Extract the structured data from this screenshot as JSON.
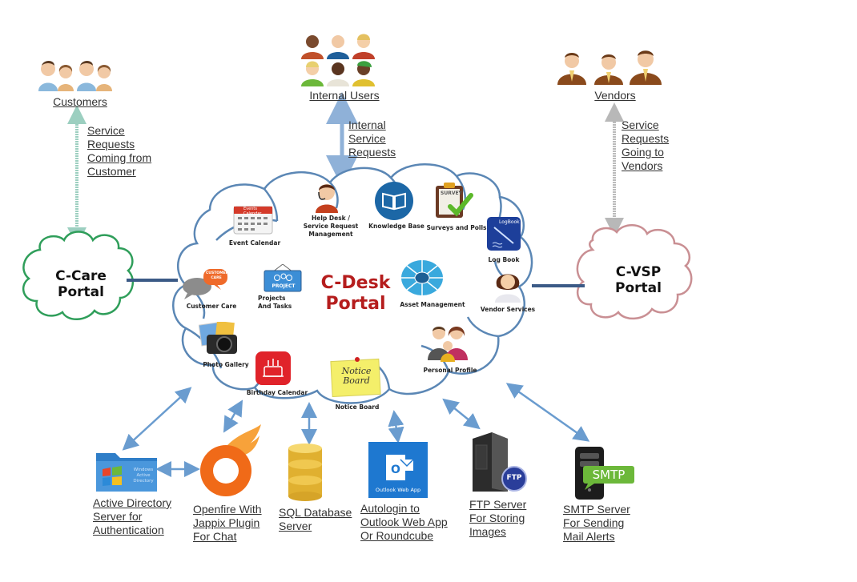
{
  "title": "C-Desk Portal",
  "top_groups": {
    "customers": {
      "label": "Customers",
      "flow": "Service\nRequests\nComing from\nCustomer"
    },
    "internal_users": {
      "label": "Internal  Users",
      "flow": "Internal\nService\nRequests"
    },
    "vendors": {
      "label": "Vendors",
      "flow": "Service\nRequests\nGoing to\nVendors"
    }
  },
  "portals": {
    "c_care": "C-Care\nPortal",
    "c_desk": "C-Desk\nPortal",
    "c_vsp": "C-VSP\nPortal"
  },
  "modules": [
    {
      "id": "event-calendar",
      "label": "Event Calendar",
      "icon": "calendar-icon"
    },
    {
      "id": "help-desk",
      "label": "Help Desk /\nService Request\nManagement",
      "icon": "headset-agent-icon"
    },
    {
      "id": "knowledge-base",
      "label": "Knowledge Base",
      "icon": "book-icon"
    },
    {
      "id": "surveys-polls",
      "label": "Surveys and Polls",
      "icon": "survey-clipboard-icon"
    },
    {
      "id": "log-book",
      "label": "Log Book",
      "icon": "logbook-icon"
    },
    {
      "id": "customer-care",
      "label": "Customer Care",
      "icon": "chat-bubbles-icon"
    },
    {
      "id": "projects-tasks",
      "label": "Projects\nAnd Tasks",
      "icon": "project-sign-icon"
    },
    {
      "id": "asset-management",
      "label": "Asset Management",
      "icon": "asset-wheel-icon"
    },
    {
      "id": "vendor-services",
      "label": "Vendor Services",
      "icon": "support-agent-icon"
    },
    {
      "id": "photo-gallery",
      "label": "Photo Gallery",
      "icon": "camera-icon"
    },
    {
      "id": "birthday-calendar",
      "label": "Birthday Calendar",
      "icon": "cake-icon"
    },
    {
      "id": "notice-board",
      "label": "Notice Board",
      "icon": "sticky-note-icon"
    },
    {
      "id": "personal-profile",
      "label": "Personal Profile",
      "icon": "family-icon"
    }
  ],
  "icon_text": {
    "event_calendar_header": "Events Calendar",
    "survey": "SURVEY",
    "logbook": "LogBook",
    "customer_care": "CUSTOMER\nCARE",
    "project": "PROJECT",
    "notice": "Notice\nBoard",
    "ad_folder": "Windows\nActive\nDirectory",
    "outlook": "Outlook Web App",
    "ftp": "FTP",
    "smtp": "SMTP"
  },
  "servers": [
    {
      "id": "active-directory",
      "label": "Active Directory\nServer for\nAuthentication"
    },
    {
      "id": "openfire",
      "label": "Openfire With\nJappix Plugin\nFor Chat"
    },
    {
      "id": "sql-db",
      "label": "SQL Database \nServer"
    },
    {
      "id": "outlook",
      "label": "Autologin to\nOutlook Web  App\nOr Roundcube"
    },
    {
      "id": "ftp",
      "label": "FTP Server\nFor Storing\n Images"
    },
    {
      "id": "smtp",
      "label": "SMTP Server\nFor Sending\n Mail  Alerts"
    }
  ],
  "colors": {
    "cdesk_outline": "#5b87b5",
    "ccare_outline": "#2f9e5a",
    "cvsp_outline": "#c98f93",
    "arrow": "#6a9ccf",
    "connector": "#3b5a86",
    "cdesk_text": "#b51d1d"
  }
}
